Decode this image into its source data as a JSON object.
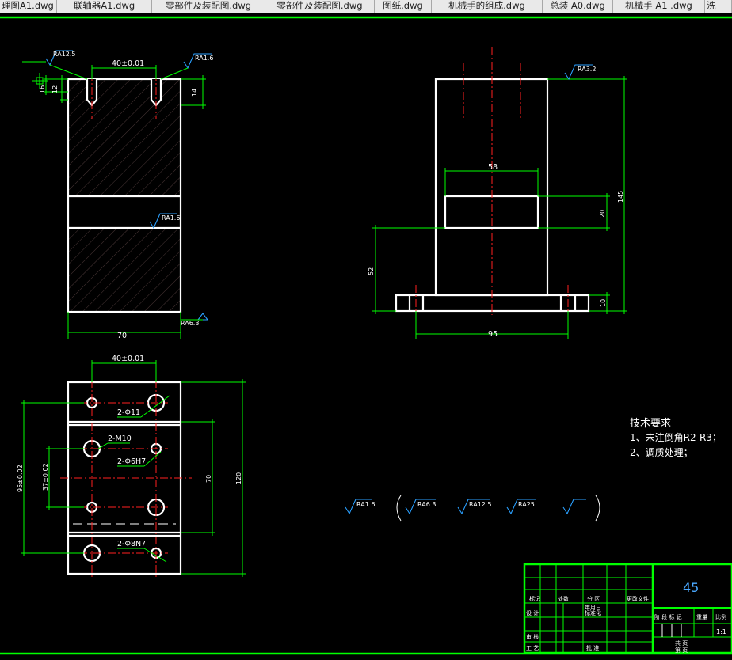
{
  "tabs": [
    {
      "label": "理图A1.dwg"
    },
    {
      "label": "联轴器A1.dwg"
    },
    {
      "label": "零部件及装配图.dwg"
    },
    {
      "label": "零部件及装配图.dwg"
    },
    {
      "label": "图纸.dwg"
    },
    {
      "label": "机械手的组成.dwg"
    },
    {
      "label": "总装 A0.dwg"
    },
    {
      "label": "机械手 A1 .dwg"
    },
    {
      "label": "洗"
    }
  ],
  "drawing": {
    "front_view": {
      "dim_top": "40±0.01",
      "dim_bottom": "70",
      "rough_tl": "RA12.5",
      "rough_tr": "RA1.6",
      "rough_mid": "RA1.6",
      "rough_br": "RA6.3",
      "dim_left_a": "16",
      "dim_left_b": "12",
      "dim_right": "14"
    },
    "side_view": {
      "rough": "RA3.2",
      "dim_slot_w": "58",
      "dim_slot_h": "20",
      "dim_height": "145",
      "dim_base_h": "10",
      "dim_left": "52",
      "dim_base_w": "95"
    },
    "top_view": {
      "dim_top": "40±0.01",
      "hole1": "2-Φ11",
      "hole2": "2-M10",
      "hole3": "2-Φ6H7",
      "hole4": "2-Φ8N7",
      "dim_left_outer": "95±0.02",
      "dim_left_inner": "37±0.02",
      "dim_right_inner": "70",
      "dim_right_outer": "120"
    },
    "rough_legend": [
      "RA1.6",
      "RA6.3",
      "RA12.5",
      "RA25"
    ],
    "tech_req": {
      "title": "技术要求",
      "line1": "1、未注倒角R2-R3；",
      "line2": "2、调质处理；"
    },
    "title_block": {
      "material": "45",
      "labels": [
        "标记",
        "处数",
        "分 区",
        "更改文件",
        "设 计",
        "标准化",
        "审 核",
        "工 艺",
        "批 准",
        "年月日",
        "阶 段 标 记",
        "重量",
        "比例",
        "共 页",
        "第 页"
      ],
      "scale": "1:1"
    }
  }
}
